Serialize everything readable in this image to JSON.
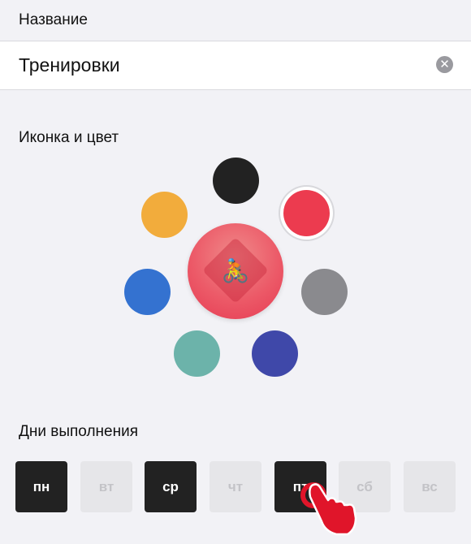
{
  "name_section": {
    "label": "Название",
    "value": "Тренировки"
  },
  "icon_section": {
    "label": "Иконка и цвет",
    "center_icon": "cyclist-emoji",
    "center_emoji": "🚴",
    "colors": [
      {
        "id": "black",
        "hex": "#222222",
        "selected": false
      },
      {
        "id": "red",
        "hex": "#ec3b4f",
        "selected": true
      },
      {
        "id": "orange",
        "hex": "#f2ac3c",
        "selected": false
      },
      {
        "id": "gray",
        "hex": "#8a8a8e",
        "selected": false
      },
      {
        "id": "blue",
        "hex": "#3472d0",
        "selected": false
      },
      {
        "id": "teal",
        "hex": "#6cb3aa",
        "selected": false
      },
      {
        "id": "indigo",
        "hex": "#3f48a9",
        "selected": false
      }
    ]
  },
  "days_section": {
    "label": "Дни выполнения",
    "days": [
      {
        "label": "пн",
        "active": true
      },
      {
        "label": "вт",
        "active": false
      },
      {
        "label": "ср",
        "active": true
      },
      {
        "label": "чт",
        "active": false
      },
      {
        "label": "пт",
        "active": true
      },
      {
        "label": "сб",
        "active": false
      },
      {
        "label": "вс",
        "active": false
      }
    ]
  },
  "icons": {
    "clear": "clear-icon",
    "tap": "hand-pointer-icon"
  }
}
